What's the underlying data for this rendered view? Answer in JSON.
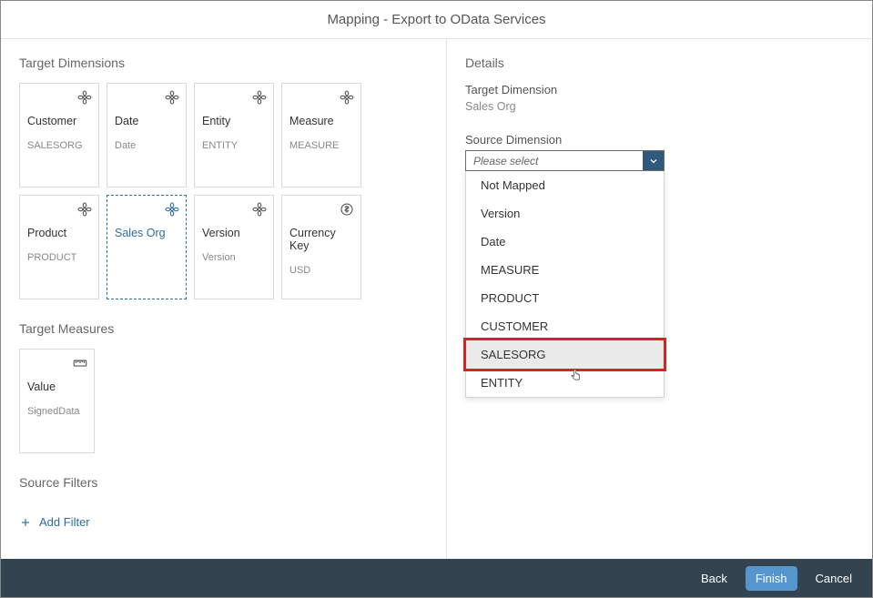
{
  "dialog": {
    "title": "Mapping - Export to OData Services"
  },
  "leftPanel": {
    "targetDimensionsTitle": "Target Dimensions",
    "dimensionCards": [
      {
        "title": "Customer",
        "subtitle": "SALESORG",
        "selected": false,
        "iconType": "fan"
      },
      {
        "title": "Date",
        "subtitle": "Date",
        "selected": false,
        "iconType": "fan"
      },
      {
        "title": "Entity",
        "subtitle": "ENTITY",
        "selected": false,
        "iconType": "fan"
      },
      {
        "title": "Measure",
        "subtitle": "MEASURE",
        "selected": false,
        "iconType": "fan"
      },
      {
        "title": "Product",
        "subtitle": "PRODUCT",
        "selected": false,
        "iconType": "fan"
      },
      {
        "title": "Sales Org",
        "subtitle": "",
        "selected": true,
        "iconType": "fan"
      },
      {
        "title": "Version",
        "subtitle": "Version",
        "selected": false,
        "iconType": "fan"
      },
      {
        "title": "Currency Key",
        "subtitle": "USD",
        "selected": false,
        "iconType": "currency"
      }
    ],
    "targetMeasuresTitle": "Target Measures",
    "measureCard": {
      "title": "Value",
      "subtitle": "SignedData",
      "iconType": "ruler"
    },
    "sourceFiltersTitle": "Source Filters",
    "addFilterLabel": "Add Filter"
  },
  "rightPanel": {
    "detailsTitle": "Details",
    "targetDimensionLabel": "Target Dimension",
    "targetDimensionValue": "Sales Org",
    "sourceDimensionLabel": "Source Dimension",
    "selectPlaceholder": "Please select",
    "dropdownOptions": [
      {
        "label": "Not Mapped",
        "highlighted": false
      },
      {
        "label": "Version",
        "highlighted": false
      },
      {
        "label": "Date",
        "highlighted": false
      },
      {
        "label": "MEASURE",
        "highlighted": false
      },
      {
        "label": "PRODUCT",
        "highlighted": false
      },
      {
        "label": "CUSTOMER",
        "highlighted": false
      },
      {
        "label": "SALESORG",
        "highlighted": true
      },
      {
        "label": "ENTITY",
        "highlighted": false
      }
    ]
  },
  "footer": {
    "back": "Back",
    "finish": "Finish",
    "cancel": "Cancel"
  }
}
